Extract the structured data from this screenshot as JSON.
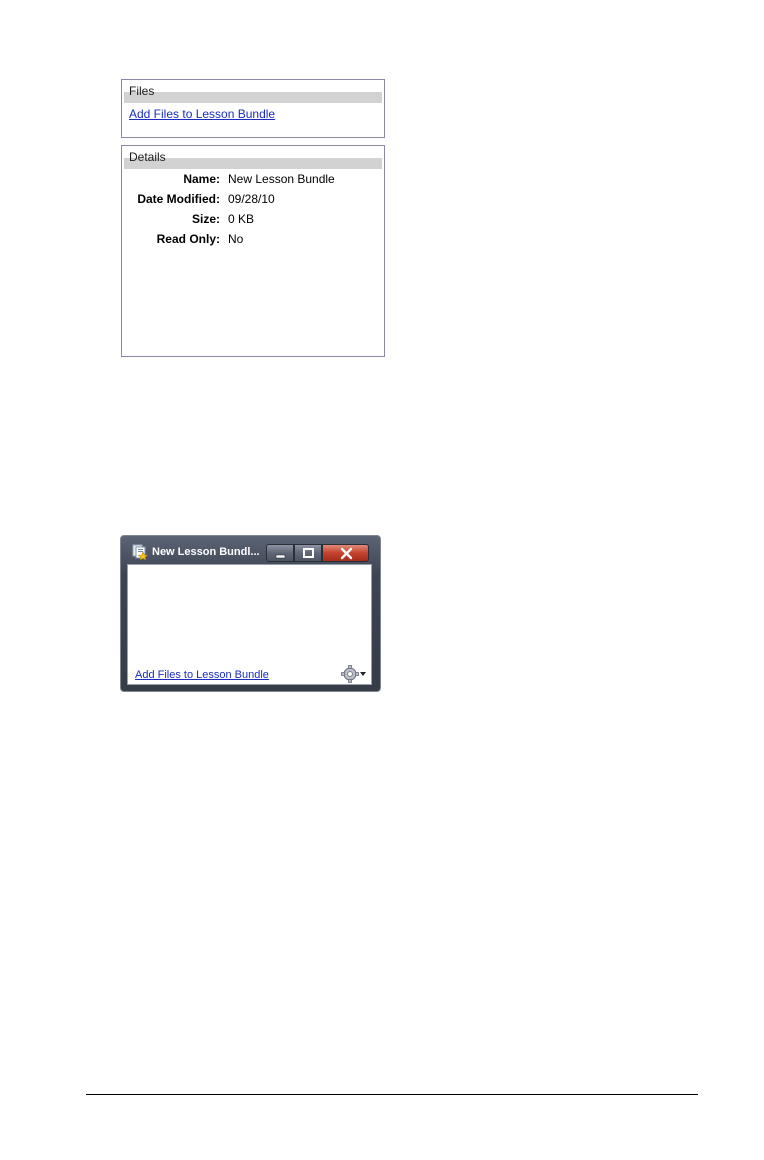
{
  "files_panel": {
    "title": "Files",
    "add_link": "Add Files to Lesson Bundle"
  },
  "details_panel": {
    "title": "Details",
    "rows": [
      {
        "label": "Name:",
        "value": "New Lesson Bundle"
      },
      {
        "label": "Date Modified:",
        "value": "09/28/10"
      },
      {
        "label": "Size:",
        "value": "0 KB"
      },
      {
        "label": "Read Only:",
        "value": "No"
      }
    ]
  },
  "window": {
    "title": "New Lesson Bundl...",
    "add_link": "Add Files to Lesson Bundle",
    "icons": {
      "app": "lesson-bundle-icon",
      "minimize": "minimize-icon",
      "maximize": "maximize-icon",
      "close": "close-icon",
      "settings": "gear-icon"
    }
  },
  "colors": {
    "link": "#1a2dbf",
    "panel_header": "#d2d2d2",
    "panel_border": "#8a8aa8",
    "window_frame": "#3d4452",
    "close_button": "#c5432f"
  }
}
